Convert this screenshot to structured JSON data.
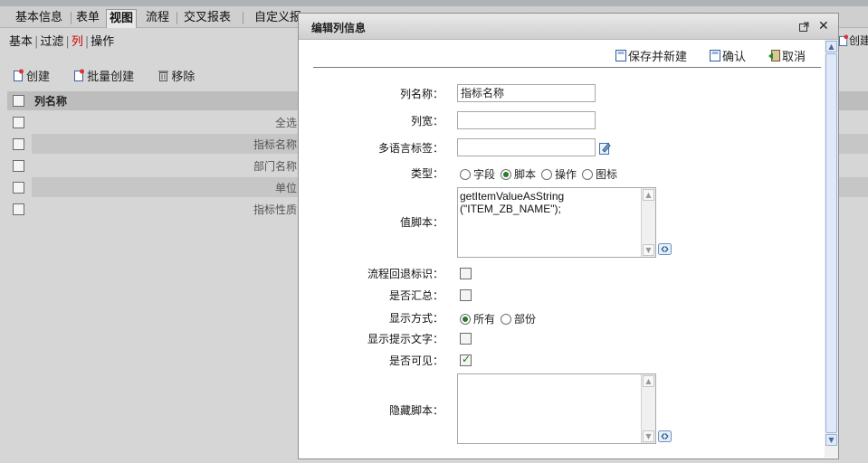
{
  "tabs": [
    {
      "label": "基本信息"
    },
    {
      "label": "表单"
    },
    {
      "label": "视图"
    },
    {
      "label": "流程"
    },
    {
      "label": "交叉报表"
    },
    {
      "label": "自定义报"
    }
  ],
  "subnav": {
    "basic": "基本",
    "filter": "过滤",
    "column": "列",
    "action": "操作"
  },
  "toolbar": {
    "create": "创建",
    "batch_create": "批量创建",
    "remove": "移除"
  },
  "right_create": "创建",
  "grid": {
    "header": "列名称",
    "rows": [
      {
        "name": "全选"
      },
      {
        "name": "指标名称"
      },
      {
        "name": "部门名称"
      },
      {
        "name": "单位"
      },
      {
        "name": "指标性质"
      }
    ]
  },
  "dialog": {
    "title": "编辑列信息",
    "buttons": {
      "save_new": "保存并新建",
      "confirm": "确认",
      "cancel": "取消"
    },
    "fields": {
      "col_name_label": "列名称：",
      "col_name_value": "指标名称",
      "col_width_label": "列宽：",
      "col_width_value": "",
      "i18n_label": "多语言标签：",
      "i18n_value": "",
      "type_label": "类型：",
      "type_options": [
        "字段",
        "脚本",
        "操作",
        "图标"
      ],
      "type_selected": "脚本",
      "value_script_label": "值脚本：",
      "value_script_line1": "getItemValueAsString",
      "value_script_line2": "(\"ITEM_ZB_NAME\");",
      "flow_back_label": "流程回退标识：",
      "summary_label": "是否汇总：",
      "display_mode_label": "显示方式：",
      "display_mode_options": [
        "所有",
        "部份"
      ],
      "display_mode_selected": "所有",
      "show_tip_label": "显示提示文字：",
      "visible_label": "是否可见：",
      "visible_checked": true,
      "hide_script_label": "隐藏脚本：",
      "hide_script_value": ""
    }
  }
}
